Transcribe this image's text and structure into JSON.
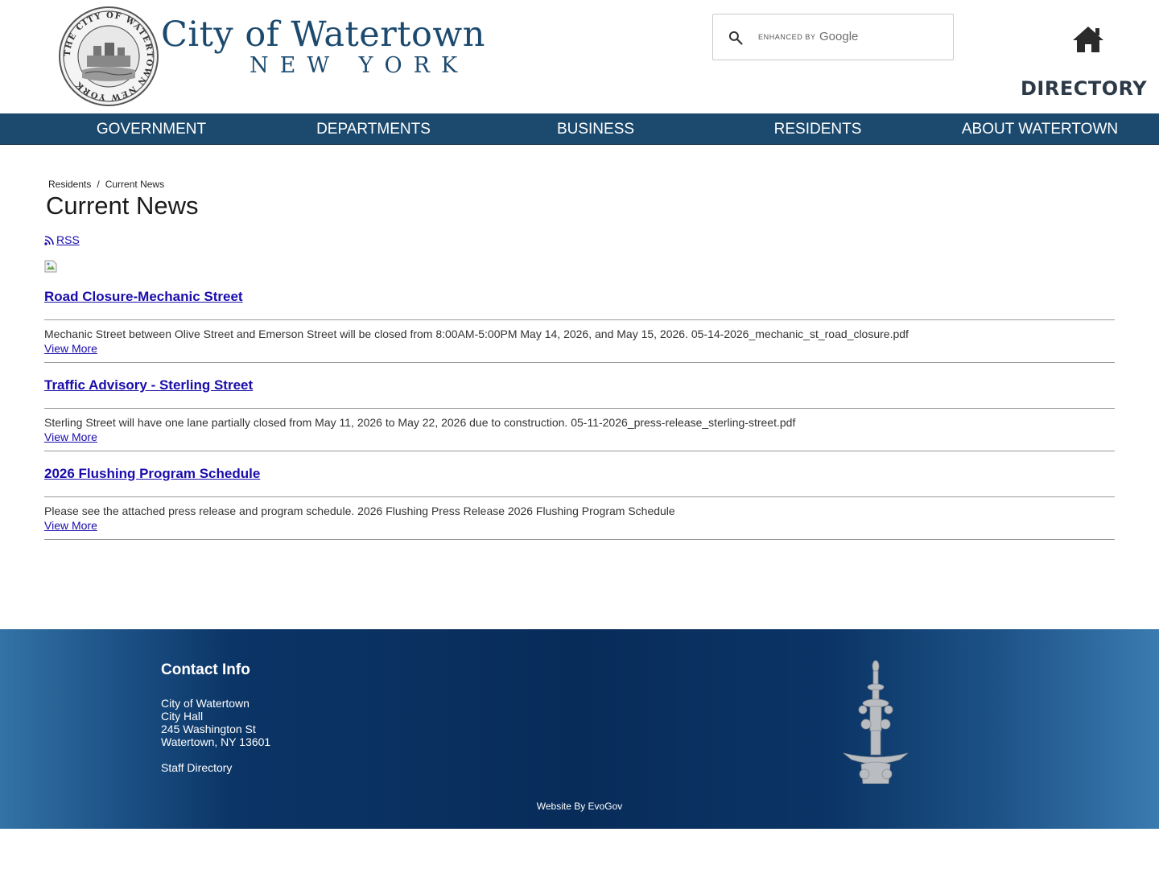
{
  "header": {
    "seal_ring_text": "THE CITY OF WATERTOWN NEW YORK",
    "city_title": "City of Watertown",
    "city_subtitle": "NEW YORK",
    "search": {
      "enhanced_label": "ENHANCED BY",
      "brand": "Google"
    },
    "directory_label": "DIRECTORY"
  },
  "nav": {
    "items": [
      {
        "label": "GOVERNMENT"
      },
      {
        "label": "DEPARTMENTS"
      },
      {
        "label": "BUSINESS"
      },
      {
        "label": "RESIDENTS"
      },
      {
        "label": "ABOUT WATERTOWN"
      }
    ]
  },
  "breadcrumb": {
    "items": [
      "Residents",
      "Current News"
    ],
    "separator": "/"
  },
  "page_title": "Current News",
  "rss_label": "RSS",
  "news": [
    {
      "title": "Road Closure-Mechanic Street",
      "body": "Mechanic Street between Olive Street and Emerson Street will be closed from 8:00AM-5:00PM May 14, 2026, and May 15, 2026. 05-14-2026_mechanic_st_road_closure.pdf",
      "link": "View More"
    },
    {
      "title": "Traffic Advisory - Sterling Street",
      "body": "Sterling Street will have one lane partially closed from May 11, 2026 to May 22, 2026 due to construction. 05-11-2026_press-release_sterling-street.pdf",
      "link": "View More"
    },
    {
      "title": "2026 Flushing Program Schedule",
      "body": "Please see the attached press release and program schedule. 2026 Flushing Press Release 2026 Flushing Program Schedule",
      "link": "View More"
    }
  ],
  "footer": {
    "contact_heading": "Contact Info",
    "lines": [
      "City of Watertown",
      "City Hall",
      "245 Washington St",
      "Watertown, NY 13601"
    ],
    "staff_directory": "Staff Directory",
    "website_by": "Website By EvoGov"
  },
  "colors": {
    "brand_blue": "#1c4a6e",
    "link_blue": "#1a0dab",
    "footer_dark": "#082c5a",
    "footer_light": "#3373a5"
  },
  "icons": [
    "seal-logo",
    "search-icon",
    "home-icon",
    "rss-icon",
    "broken-image-icon",
    "fountain-image"
  ]
}
